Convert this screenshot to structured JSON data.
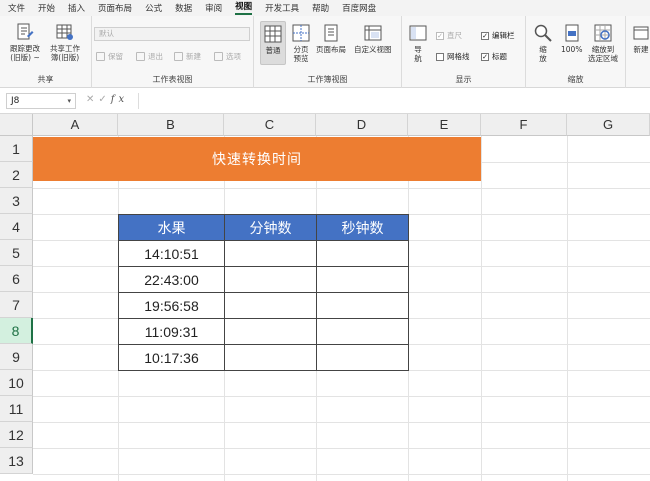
{
  "menu": [
    "文件",
    "开始",
    "插入",
    "页面布局",
    "公式",
    "数据",
    "审阅",
    "视图",
    "开发工具",
    "帮助",
    "百度网盘"
  ],
  "menu_active": "视图",
  "ribbon": {
    "share_group": {
      "label": "共享",
      "btn1": "跟踪更改\n(旧版) ~",
      "btn2": "共享工作\n簿(旧版)"
    },
    "sheet_view_group": {
      "label": "工作表视图",
      "dropdown": "默认",
      "keep": "保留",
      "exit": "退出",
      "new": "新建",
      "options": "选项"
    },
    "workbook_view_group": {
      "label": "工作簿视图",
      "normal": "普通",
      "page_break": "分页\n预览",
      "page_layout": "页面布局",
      "custom": "自定义视图"
    },
    "show_group": {
      "label": "显示",
      "nav": "导\n航",
      "ruler": "直尺",
      "gridlines": "网格线",
      "formula_bar": "编辑栏",
      "headings": "标题"
    },
    "zoom_group": {
      "label": "缩放",
      "zoom": "缩\n放",
      "zoom100": "100%",
      "zoom_sel": "缩放到\n选定区域"
    },
    "new_window": "新建"
  },
  "formula_bar": {
    "name_box": "J8",
    "fx": "fx"
  },
  "columns": [
    "A",
    "B",
    "C",
    "D",
    "E",
    "F",
    "G"
  ],
  "rows": [
    "1",
    "2",
    "3",
    "4",
    "5",
    "6",
    "7",
    "8",
    "9",
    "10",
    "11",
    "12",
    "13"
  ],
  "selected_row": "8",
  "banner_title": "快速转换时间",
  "table": {
    "headers": [
      "水果",
      "分钟数",
      "秒钟数"
    ],
    "rows": [
      [
        "14:10:51",
        "",
        ""
      ],
      [
        "22:43:00",
        "",
        ""
      ],
      [
        "19:56:58",
        "",
        ""
      ],
      [
        "11:09:31",
        "",
        ""
      ],
      [
        "10:17:36",
        "",
        ""
      ]
    ]
  },
  "colors": {
    "banner": "#ed7d31",
    "table_header": "#4472c4",
    "accent": "#1e7145"
  }
}
